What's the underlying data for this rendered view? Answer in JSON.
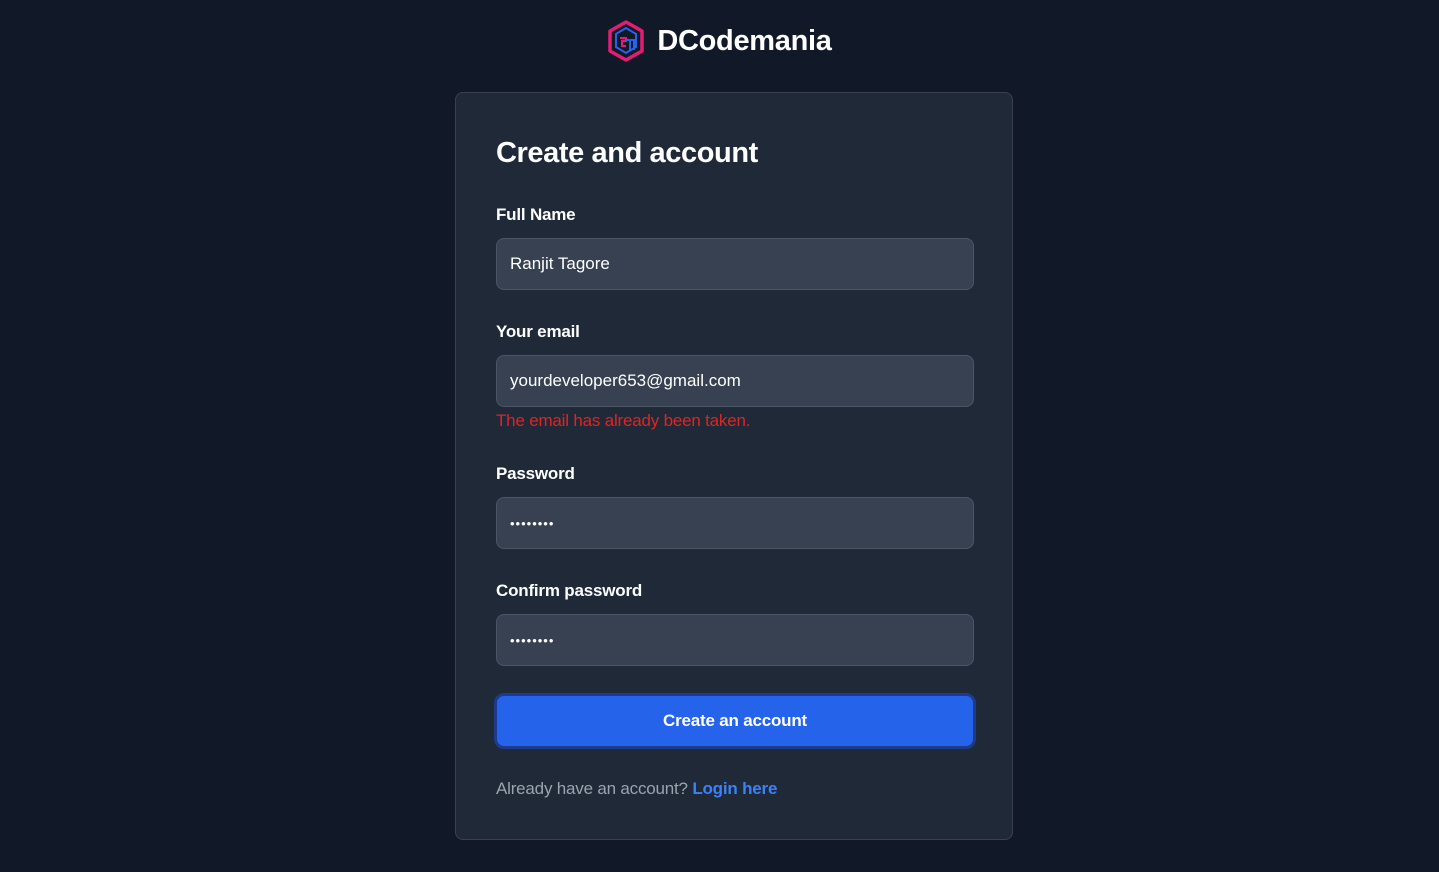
{
  "brand": {
    "name": "DCodemania",
    "logo_icon": "cube-logo-icon",
    "logo_colors": [
      "#e11d74",
      "#2563eb"
    ]
  },
  "form": {
    "title": "Create and account",
    "fields": [
      {
        "label": "Full Name",
        "value": "Ranjit Tagore",
        "type": "text"
      },
      {
        "label": "Your email",
        "value": "yourdeveloper653@gmail.com",
        "type": "email",
        "error": "The email has already been taken."
      },
      {
        "label": "Password",
        "value": "••••••••",
        "type": "password"
      },
      {
        "label": "Confirm password",
        "value": "••••••••",
        "type": "password"
      }
    ],
    "submit_label": "Create an account",
    "footer_text": "Already have an account?",
    "login_link_label": "Login here"
  },
  "colors": {
    "background": "#111827",
    "card": "#1f2937",
    "input": "#374151",
    "accent": "#2563eb",
    "error": "#e02424",
    "link": "#3b82f6"
  }
}
